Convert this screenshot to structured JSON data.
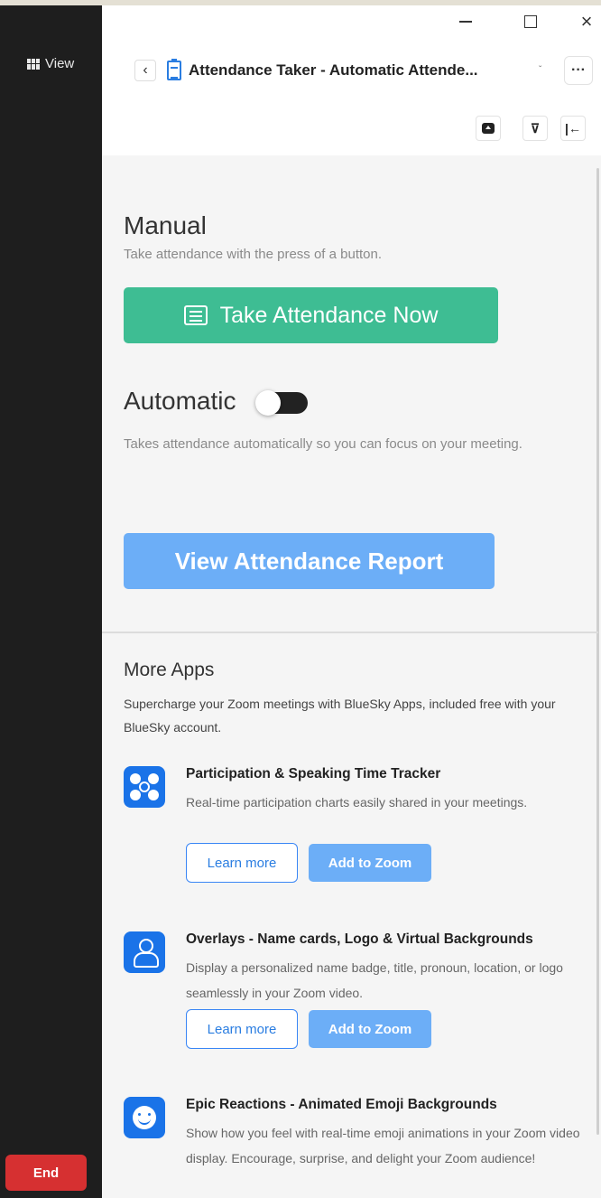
{
  "left_pane": {
    "view_label": "View",
    "end_label": "End"
  },
  "window_controls": {
    "close_glyph": "×"
  },
  "header": {
    "back_glyph": "‹",
    "title": "Attendance Taker - Automatic Attende...",
    "chevron_glyph": "ˇ",
    "more_glyph": "···",
    "toolbar": {
      "filter_glyph": "⊽",
      "collapse_glyph": "|←"
    }
  },
  "manual": {
    "title": "Manual",
    "description": "Take attendance with the press of a button.",
    "button_label": "Take Attendance Now"
  },
  "automatic": {
    "title": "Automatic",
    "toggle_on": false,
    "description": "Takes attendance automatically so you can focus on your meeting."
  },
  "report": {
    "button_label": "View Attendance Report"
  },
  "more_apps": {
    "title": "More Apps",
    "description": "Supercharge your Zoom meetings with BlueSky Apps, included free with your BlueSky account.",
    "items": [
      {
        "name": "Participation & Speaking Time Tracker",
        "description": "Real-time participation charts easily shared in your meetings.",
        "learn_label": "Learn more",
        "add_label": "Add to Zoom",
        "icon": "participants-icon"
      },
      {
        "name": "Overlays - Name cards, Logo & Virtual Backgrounds",
        "description": "Display a personalized name badge, title, pronoun, location, or logo seamlessly in your Zoom video.",
        "learn_label": "Learn more",
        "add_label": "Add to Zoom",
        "icon": "name-card-icon"
      },
      {
        "name": "Epic Reactions - Animated Emoji Backgrounds",
        "description": "Show how you feel with real-time emoji animations in your Zoom video display. Encourage, surprise, and delight your Zoom audience!",
        "icon": "smiley-icon"
      }
    ]
  },
  "colors": {
    "take_button": "#3ebd93",
    "report_button": "#6caef7",
    "end_button": "#d63031",
    "app_icon": "#1a73e8"
  }
}
